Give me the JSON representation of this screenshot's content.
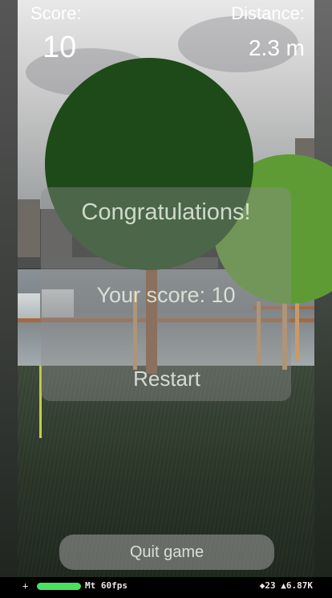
{
  "hud": {
    "score_label": "Score:",
    "score_value": "10",
    "distance_label": "Distance:",
    "distance_value": "2.3 m"
  },
  "dialog": {
    "title": "Congratulations!",
    "score_text": "Your score: 10",
    "restart_label": "Restart"
  },
  "controls": {
    "quit_label": "Quit game"
  },
  "stats": {
    "plus": "+",
    "fps_text": "Mt 60fps",
    "right_text": "◆23 ▲6.87K"
  },
  "colors": {
    "tree_dark": "#1e4a19",
    "tree_light": "#5f9b34",
    "trunk": "#8a5c3e",
    "fps_bar": "#49e25d"
  }
}
